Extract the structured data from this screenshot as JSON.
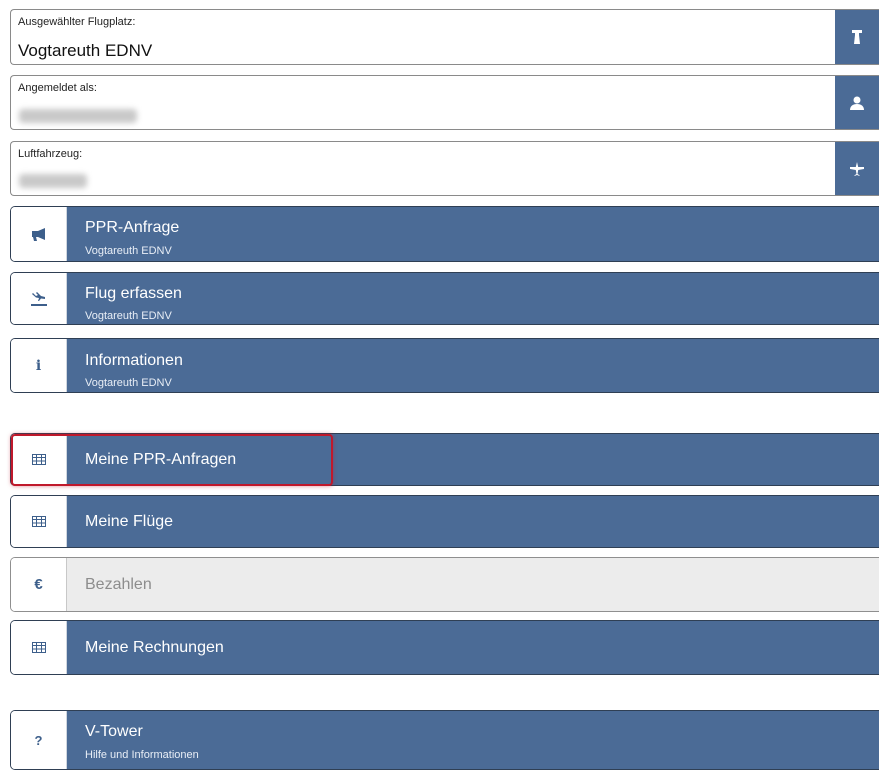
{
  "fields": {
    "airfield": {
      "label": "Ausgewählter Flugplatz:",
      "value": "Vogtareuth EDNV",
      "icon": "tower-icon"
    },
    "user": {
      "label": "Angemeldet als:",
      "value": "",
      "icon": "user-icon"
    },
    "aircraft": {
      "label": "Luftfahrzeug:",
      "value": "",
      "icon": "airplane-icon"
    }
  },
  "menu": {
    "ppr_request": {
      "title": "PPR-Anfrage",
      "subtitle": "Vogtareuth EDNV",
      "icon": "megaphone-icon"
    },
    "log_flight": {
      "title": "Flug erfassen",
      "subtitle": "Vogtareuth EDNV",
      "icon": "plane-landing-icon"
    },
    "information": {
      "title": "Informationen",
      "subtitle": "Vogtareuth EDNV",
      "icon": "info-icon"
    },
    "my_ppr_requests": {
      "title": "Meine PPR-Anfragen",
      "icon": "table-icon"
    },
    "my_flights": {
      "title": "Meine Flüge",
      "icon": "table-icon"
    },
    "pay": {
      "title": "Bezahlen",
      "icon": "euro-icon"
    },
    "my_invoices": {
      "title": "Meine Rechnungen",
      "icon": "table-icon"
    },
    "vtower": {
      "title": "V-Tower",
      "subtitle": "Hilfe und Informationen",
      "icon": "question-icon"
    }
  },
  "colors": {
    "primary": "#4b6b96",
    "icon": "#3d5f8b",
    "disabled": "#ececec",
    "highlight": "#c0182b"
  }
}
